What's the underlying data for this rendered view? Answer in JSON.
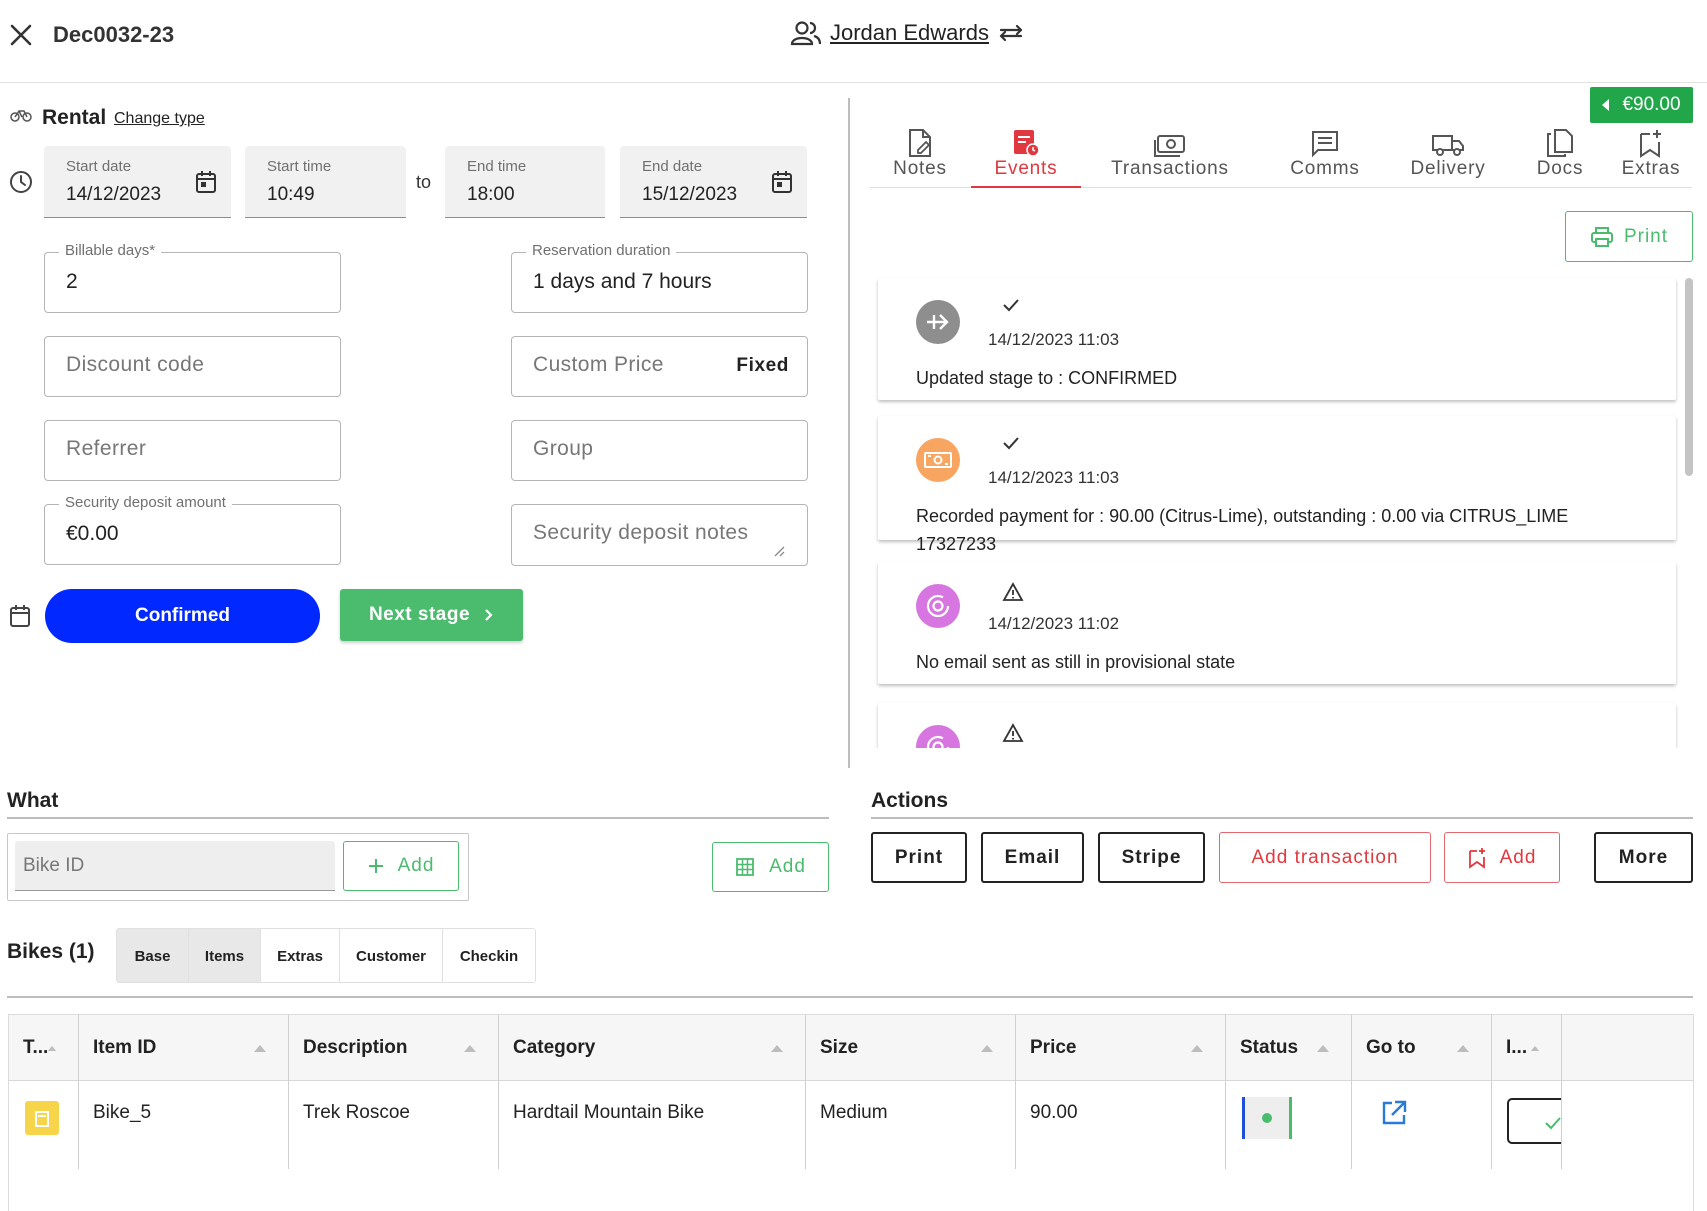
{
  "header": {
    "booking_id": "Dec0032-23",
    "customer_name": "Jordan Edwards"
  },
  "rental": {
    "title": "Rental",
    "change_type": "Change type",
    "start_date_label": "Start date",
    "start_date": "14/12/2023",
    "start_time_label": "Start time",
    "start_time": "10:49",
    "to": "to",
    "end_time_label": "End time",
    "end_time": "18:00",
    "end_date_label": "End date",
    "end_date": "15/12/2023",
    "billable_days_label": "Billable days*",
    "billable_days": "2",
    "reservation_duration_label": "Reservation duration",
    "reservation_duration": "1 days and 7 hours",
    "discount_code_placeholder": "Discount code",
    "custom_price_placeholder": "Custom Price",
    "fixed_label": "Fixed",
    "referrer_placeholder": "Referrer",
    "group_placeholder": "Group",
    "security_deposit_label": "Security deposit amount",
    "security_deposit": "€0.00",
    "security_deposit_notes_placeholder": "Security deposit notes",
    "stage_button": "Confirmed",
    "next_stage_button": "Next stage"
  },
  "right_panel": {
    "amount": "€90.00",
    "tabs": [
      {
        "label": "Notes",
        "icon": "notes-icon"
      },
      {
        "label": "Events",
        "icon": "events-icon"
      },
      {
        "label": "Transactions",
        "icon": "transactions-icon"
      },
      {
        "label": "Comms",
        "icon": "comms-icon"
      },
      {
        "label": "Delivery",
        "icon": "delivery-icon"
      },
      {
        "label": "Docs",
        "icon": "docs-icon"
      },
      {
        "label": "Extras",
        "icon": "extras-icon"
      }
    ],
    "active_tab": "Events",
    "print_label": "Print",
    "events": [
      {
        "icon": "arrow-right-icon",
        "mark": "check",
        "date": "14/12/2023 11:03",
        "text": "Updated stage to : CONFIRMED"
      },
      {
        "icon": "payment-icon",
        "mark": "check",
        "date": "14/12/2023 11:03",
        "text": "Recorded payment for : 90.00 (Citrus-Lime), outstanding : 0.00 via CITRUS_LIME 17327233"
      },
      {
        "icon": "target-icon",
        "mark": "warning",
        "date": "14/12/2023 11:02",
        "text": "No email sent as still in provisional state"
      },
      {
        "icon": "target-icon",
        "mark": "warning",
        "date": "",
        "text": ""
      }
    ]
  },
  "what": {
    "title": "What",
    "bike_id_placeholder": "Bike ID",
    "add_label": "Add",
    "grid_add_label": "Add"
  },
  "actions": {
    "title": "Actions",
    "print": "Print",
    "email": "Email",
    "stripe": "Stripe",
    "add_transaction": "Add transaction",
    "add": "Add",
    "more": "More"
  },
  "bikes": {
    "title": "Bikes (1)",
    "subtabs": [
      "Base",
      "Items",
      "Extras",
      "Customer",
      "Checkin"
    ],
    "columns": [
      "T...",
      "Item ID",
      "Description",
      "Category",
      "Size",
      "Price",
      "Status",
      "Go to",
      "I..."
    ],
    "rows": [
      {
        "item_id": "Bike_5",
        "description": "Trek Roscoe",
        "category": "Hardtail Mountain Bike",
        "size": "Medium",
        "price": "90.00"
      }
    ]
  },
  "colors": {
    "primary_blue": "#0028ff",
    "success_green": "#4bbb6d",
    "badge_green": "#21a649",
    "accent_red": "#e0383e"
  }
}
